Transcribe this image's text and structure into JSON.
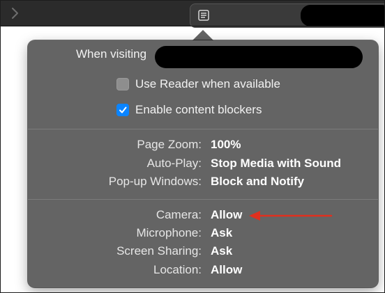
{
  "window": {
    "accent_color": "#0a84ff",
    "annotation_color": "#e0301e"
  },
  "toolbar": {
    "back_icon": "chevron-left-icon",
    "reader_icon": "reader-icon"
  },
  "popover": {
    "visiting_label": "When visiting",
    "options": [
      {
        "label": "Use Reader when available",
        "checked": false
      },
      {
        "label": "Enable content blockers",
        "checked": true
      }
    ],
    "general_settings": [
      {
        "label": "Page Zoom:",
        "value": "100%"
      },
      {
        "label": "Auto-Play:",
        "value": "Stop Media with Sound"
      },
      {
        "label": "Pop-up Windows:",
        "value": "Block and Notify"
      }
    ],
    "permission_settings": [
      {
        "label": "Camera:",
        "value": "Allow"
      },
      {
        "label": "Microphone:",
        "value": "Ask"
      },
      {
        "label": "Screen Sharing:",
        "value": "Ask"
      },
      {
        "label": "Location:",
        "value": "Allow"
      }
    ]
  }
}
